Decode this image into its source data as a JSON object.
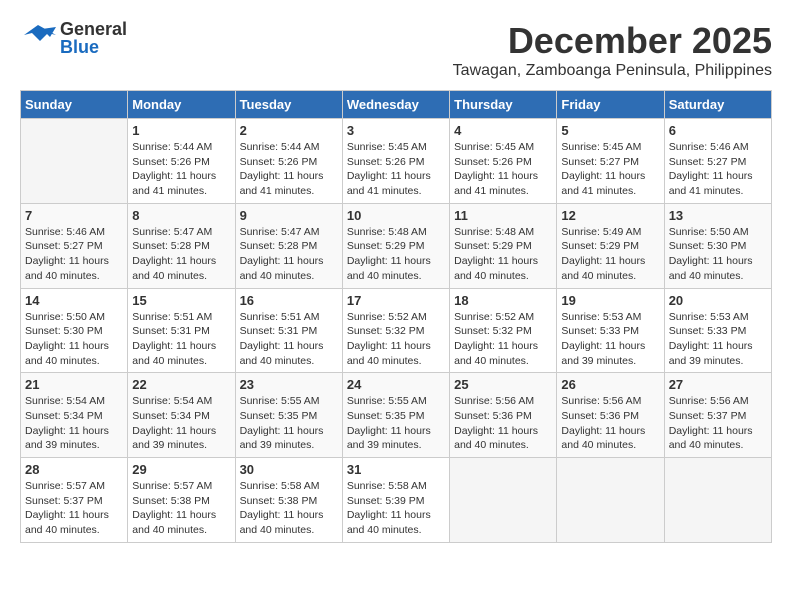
{
  "header": {
    "logo_general": "General",
    "logo_blue": "Blue",
    "month_title": "December 2025",
    "location": "Tawagan, Zamboanga Peninsula, Philippines"
  },
  "weekdays": [
    "Sunday",
    "Monday",
    "Tuesday",
    "Wednesday",
    "Thursday",
    "Friday",
    "Saturday"
  ],
  "weeks": [
    [
      {
        "day": "",
        "sunrise": "",
        "sunset": "",
        "daylight": ""
      },
      {
        "day": "1",
        "sunrise": "Sunrise: 5:44 AM",
        "sunset": "Sunset: 5:26 PM",
        "daylight": "Daylight: 11 hours and 41 minutes."
      },
      {
        "day": "2",
        "sunrise": "Sunrise: 5:44 AM",
        "sunset": "Sunset: 5:26 PM",
        "daylight": "Daylight: 11 hours and 41 minutes."
      },
      {
        "day": "3",
        "sunrise": "Sunrise: 5:45 AM",
        "sunset": "Sunset: 5:26 PM",
        "daylight": "Daylight: 11 hours and 41 minutes."
      },
      {
        "day": "4",
        "sunrise": "Sunrise: 5:45 AM",
        "sunset": "Sunset: 5:26 PM",
        "daylight": "Daylight: 11 hours and 41 minutes."
      },
      {
        "day": "5",
        "sunrise": "Sunrise: 5:45 AM",
        "sunset": "Sunset: 5:27 PM",
        "daylight": "Daylight: 11 hours and 41 minutes."
      },
      {
        "day": "6",
        "sunrise": "Sunrise: 5:46 AM",
        "sunset": "Sunset: 5:27 PM",
        "daylight": "Daylight: 11 hours and 41 minutes."
      }
    ],
    [
      {
        "day": "7",
        "sunrise": "Sunrise: 5:46 AM",
        "sunset": "Sunset: 5:27 PM",
        "daylight": "Daylight: 11 hours and 40 minutes."
      },
      {
        "day": "8",
        "sunrise": "Sunrise: 5:47 AM",
        "sunset": "Sunset: 5:28 PM",
        "daylight": "Daylight: 11 hours and 40 minutes."
      },
      {
        "day": "9",
        "sunrise": "Sunrise: 5:47 AM",
        "sunset": "Sunset: 5:28 PM",
        "daylight": "Daylight: 11 hours and 40 minutes."
      },
      {
        "day": "10",
        "sunrise": "Sunrise: 5:48 AM",
        "sunset": "Sunset: 5:29 PM",
        "daylight": "Daylight: 11 hours and 40 minutes."
      },
      {
        "day": "11",
        "sunrise": "Sunrise: 5:48 AM",
        "sunset": "Sunset: 5:29 PM",
        "daylight": "Daylight: 11 hours and 40 minutes."
      },
      {
        "day": "12",
        "sunrise": "Sunrise: 5:49 AM",
        "sunset": "Sunset: 5:29 PM",
        "daylight": "Daylight: 11 hours and 40 minutes."
      },
      {
        "day": "13",
        "sunrise": "Sunrise: 5:50 AM",
        "sunset": "Sunset: 5:30 PM",
        "daylight": "Daylight: 11 hours and 40 minutes."
      }
    ],
    [
      {
        "day": "14",
        "sunrise": "Sunrise: 5:50 AM",
        "sunset": "Sunset: 5:30 PM",
        "daylight": "Daylight: 11 hours and 40 minutes."
      },
      {
        "day": "15",
        "sunrise": "Sunrise: 5:51 AM",
        "sunset": "Sunset: 5:31 PM",
        "daylight": "Daylight: 11 hours and 40 minutes."
      },
      {
        "day": "16",
        "sunrise": "Sunrise: 5:51 AM",
        "sunset": "Sunset: 5:31 PM",
        "daylight": "Daylight: 11 hours and 40 minutes."
      },
      {
        "day": "17",
        "sunrise": "Sunrise: 5:52 AM",
        "sunset": "Sunset: 5:32 PM",
        "daylight": "Daylight: 11 hours and 40 minutes."
      },
      {
        "day": "18",
        "sunrise": "Sunrise: 5:52 AM",
        "sunset": "Sunset: 5:32 PM",
        "daylight": "Daylight: 11 hours and 40 minutes."
      },
      {
        "day": "19",
        "sunrise": "Sunrise: 5:53 AM",
        "sunset": "Sunset: 5:33 PM",
        "daylight": "Daylight: 11 hours and 39 minutes."
      },
      {
        "day": "20",
        "sunrise": "Sunrise: 5:53 AM",
        "sunset": "Sunset: 5:33 PM",
        "daylight": "Daylight: 11 hours and 39 minutes."
      }
    ],
    [
      {
        "day": "21",
        "sunrise": "Sunrise: 5:54 AM",
        "sunset": "Sunset: 5:34 PM",
        "daylight": "Daylight: 11 hours and 39 minutes."
      },
      {
        "day": "22",
        "sunrise": "Sunrise: 5:54 AM",
        "sunset": "Sunset: 5:34 PM",
        "daylight": "Daylight: 11 hours and 39 minutes."
      },
      {
        "day": "23",
        "sunrise": "Sunrise: 5:55 AM",
        "sunset": "Sunset: 5:35 PM",
        "daylight": "Daylight: 11 hours and 39 minutes."
      },
      {
        "day": "24",
        "sunrise": "Sunrise: 5:55 AM",
        "sunset": "Sunset: 5:35 PM",
        "daylight": "Daylight: 11 hours and 39 minutes."
      },
      {
        "day": "25",
        "sunrise": "Sunrise: 5:56 AM",
        "sunset": "Sunset: 5:36 PM",
        "daylight": "Daylight: 11 hours and 40 minutes."
      },
      {
        "day": "26",
        "sunrise": "Sunrise: 5:56 AM",
        "sunset": "Sunset: 5:36 PM",
        "daylight": "Daylight: 11 hours and 40 minutes."
      },
      {
        "day": "27",
        "sunrise": "Sunrise: 5:56 AM",
        "sunset": "Sunset: 5:37 PM",
        "daylight": "Daylight: 11 hours and 40 minutes."
      }
    ],
    [
      {
        "day": "28",
        "sunrise": "Sunrise: 5:57 AM",
        "sunset": "Sunset: 5:37 PM",
        "daylight": "Daylight: 11 hours and 40 minutes."
      },
      {
        "day": "29",
        "sunrise": "Sunrise: 5:57 AM",
        "sunset": "Sunset: 5:38 PM",
        "daylight": "Daylight: 11 hours and 40 minutes."
      },
      {
        "day": "30",
        "sunrise": "Sunrise: 5:58 AM",
        "sunset": "Sunset: 5:38 PM",
        "daylight": "Daylight: 11 hours and 40 minutes."
      },
      {
        "day": "31",
        "sunrise": "Sunrise: 5:58 AM",
        "sunset": "Sunset: 5:39 PM",
        "daylight": "Daylight: 11 hours and 40 minutes."
      },
      {
        "day": "",
        "sunrise": "",
        "sunset": "",
        "daylight": ""
      },
      {
        "day": "",
        "sunrise": "",
        "sunset": "",
        "daylight": ""
      },
      {
        "day": "",
        "sunrise": "",
        "sunset": "",
        "daylight": ""
      }
    ]
  ]
}
